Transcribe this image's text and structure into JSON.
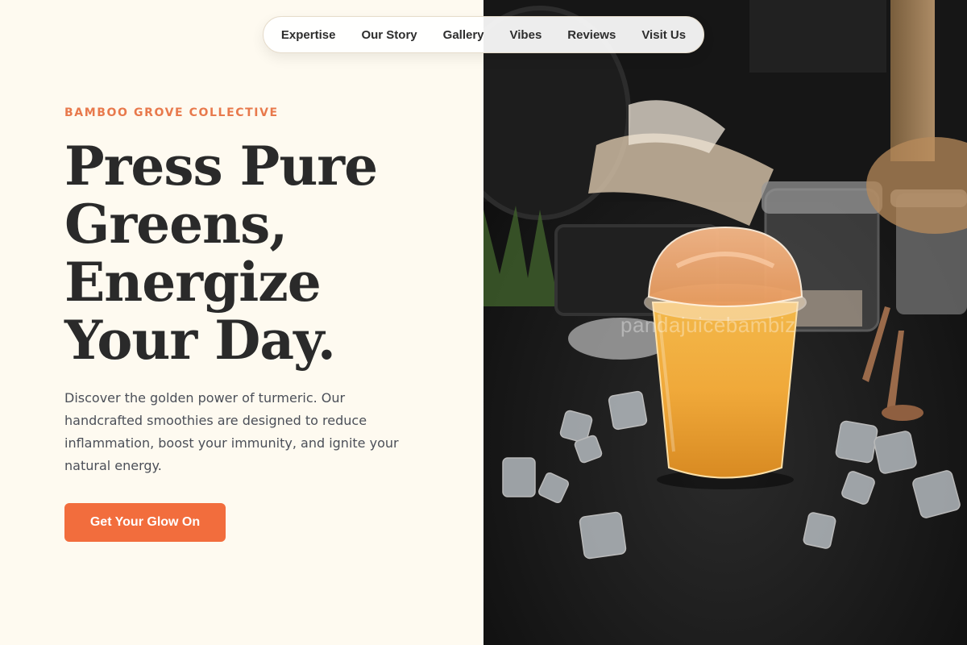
{
  "nav": {
    "items": [
      "Expertise",
      "Our Story",
      "Gallery",
      "Vibes",
      "Reviews",
      "Visit Us"
    ]
  },
  "hero": {
    "eyebrow": "BAMBOO GROVE COLLECTIVE",
    "headline_lines": [
      "Press Pure",
      "Greens,",
      "Energize",
      "Your Day."
    ],
    "description": "Discover the golden power of turmeric. Our handcrafted smoothies are designed to reduce inflammation, boost your immunity, and ignite your natural energy.",
    "cta_label": "Get Your Glow On"
  },
  "photo": {
    "watermark": "pandajuicebambiz"
  },
  "colors": {
    "accent": "#f26d3d",
    "eyebrow": "#e8794c",
    "background": "#fefaf0",
    "heading": "#2a2a2a"
  }
}
